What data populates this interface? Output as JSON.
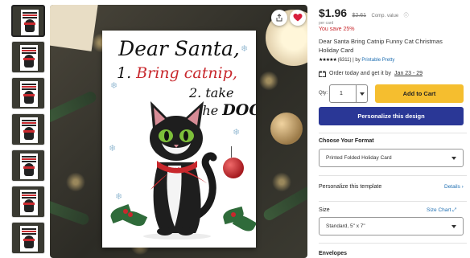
{
  "thumbnails": {
    "count": 7,
    "active_index": 0
  },
  "image": {
    "card_line1": "Dear Santa,",
    "card_line2_prefix": "1. ",
    "card_line2_highlight": "Bring catnip,",
    "card_line3": "2. take",
    "card_line4_prefix": "the ",
    "card_line4_highlight": "DOG",
    "share_icon": "share-icon",
    "favorite_icon": "heart-icon"
  },
  "product": {
    "price": "$1.96",
    "old_price": "$2.61",
    "comp_value_label": "Comp. value",
    "per_card": "per card",
    "savings": "You save 25%",
    "title": "Dear Santa Bring Catnip Funny Cat Christmas Holiday Card",
    "stars": "★★★★★",
    "reviews": "(6311)",
    "by_label": "| by",
    "seller": "Printable Pretty",
    "delivery_text": "Order today and get it by",
    "delivery_date": "Jan 23 - 29"
  },
  "purchase": {
    "qty_label": "Qty:",
    "qty_value": "1",
    "add_to_cart": "Add to Cart",
    "personalize": "Personalize this design"
  },
  "format": {
    "label": "Choose Your Format",
    "selected": "Printed Folded Holiday Card"
  },
  "personalize_template": {
    "label": "Personalize this template",
    "details_link": "Details"
  },
  "size": {
    "label": "Size",
    "chart_link": "Size Chart",
    "selected": "Standard, 5\" x 7\""
  },
  "envelopes": {
    "label": "Envelopes"
  },
  "colors": {
    "accent_yellow": "#f5be2f",
    "accent_navy": "#2a3796",
    "sale_red": "#c8282d",
    "link_blue": "#1f6fb2"
  }
}
